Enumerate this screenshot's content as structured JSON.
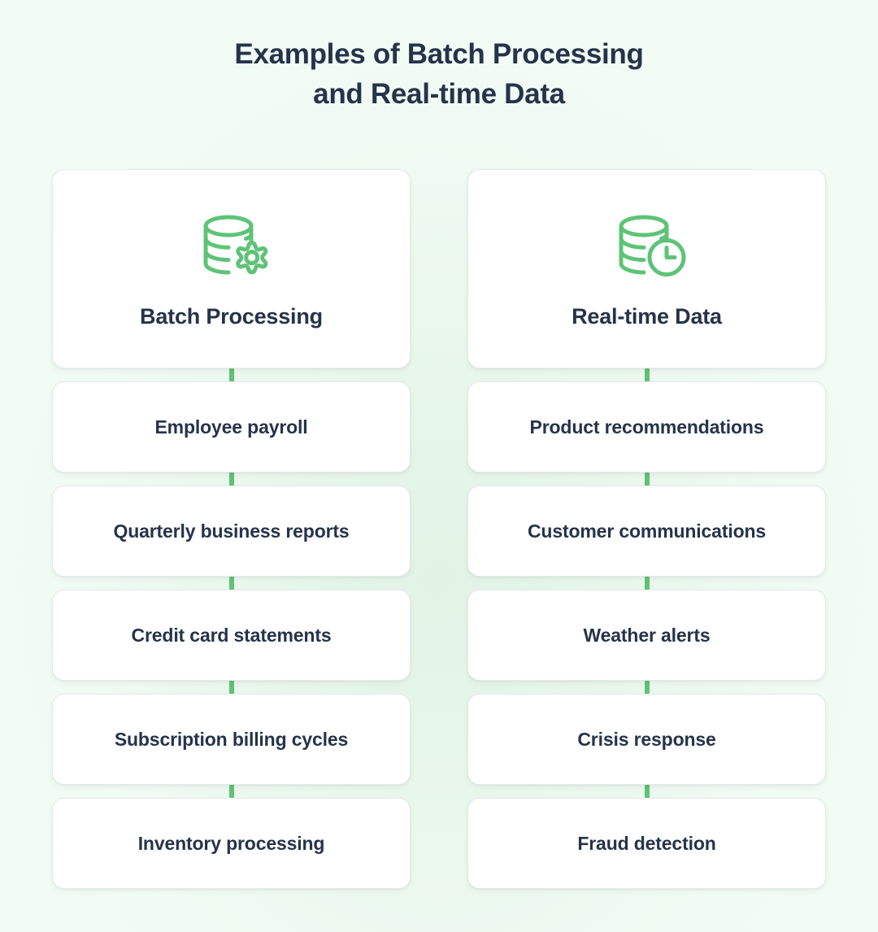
{
  "page": {
    "title_lines": [
      "Examples of Batch Processing",
      "and Real-time Data"
    ],
    "background_color": "#f0fbf3",
    "accent_color": "#61c275",
    "text_color": "#26334a",
    "card_color": "#ffffff"
  },
  "columns": [
    {
      "id": "batch-processing",
      "header": {
        "title": "Batch Processing",
        "icon": "database-gear-icon",
        "icon_color": "#5fc377"
      },
      "items": [
        {
          "label": "Employee payroll"
        },
        {
          "label": "Quarterly business reports"
        },
        {
          "label": "Credit card statements"
        },
        {
          "label": "Subscription billing cycles"
        },
        {
          "label": "Inventory processing"
        }
      ]
    },
    {
      "id": "real-time-data",
      "header": {
        "title": "Real-time Data",
        "icon": "database-clock-icon",
        "icon_color": "#5fc377"
      },
      "items": [
        {
          "label": "Product recommendations"
        },
        {
          "label": "Customer communications"
        },
        {
          "label": "Weather alerts"
        },
        {
          "label": "Crisis response"
        },
        {
          "label": "Fraud detection"
        }
      ]
    }
  ]
}
